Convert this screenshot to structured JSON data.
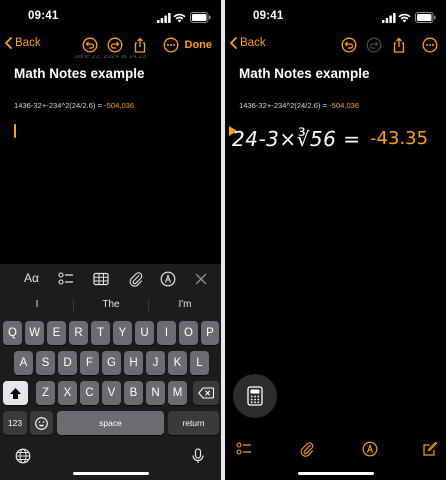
{
  "status": {
    "time": "09:41"
  },
  "nav": {
    "back_label": "Back",
    "done_label": "Done"
  },
  "note": {
    "date": "June 22, 2024 at 14:25",
    "title": "Math Notes example",
    "expression": "1436-32+-234^2(24/2.6) =",
    "expression_result": "-504,036"
  },
  "keyboard": {
    "toolbar_aa": "Aα",
    "suggestions": [
      "I",
      "The",
      "I'm"
    ],
    "row1": [
      "Q",
      "W",
      "E",
      "R",
      "T",
      "Y",
      "U",
      "I",
      "O",
      "P"
    ],
    "row2": [
      "A",
      "S",
      "D",
      "F",
      "G",
      "H",
      "J",
      "K",
      "L"
    ],
    "row3": [
      "Z",
      "X",
      "C",
      "V",
      "B",
      "N",
      "M"
    ],
    "num_label": "123",
    "space_label": "space",
    "return_label": "return"
  },
  "handwriting": {
    "expression": "24-3×∛56 =",
    "result": "-43.35"
  },
  "colors": {
    "accent": "#ff9f0a",
    "background": "#000000",
    "key": "#6c6c70",
    "key_dark": "#3a3a3c"
  },
  "icons": [
    "undo-icon",
    "redo-icon",
    "share-icon",
    "more-icon",
    "checklist-icon",
    "table-icon",
    "attachment-icon",
    "markup-icon",
    "close-icon",
    "shift-icon",
    "delete-icon",
    "emoji-icon",
    "globe-icon",
    "mic-icon",
    "calculator-icon",
    "compose-icon"
  ]
}
